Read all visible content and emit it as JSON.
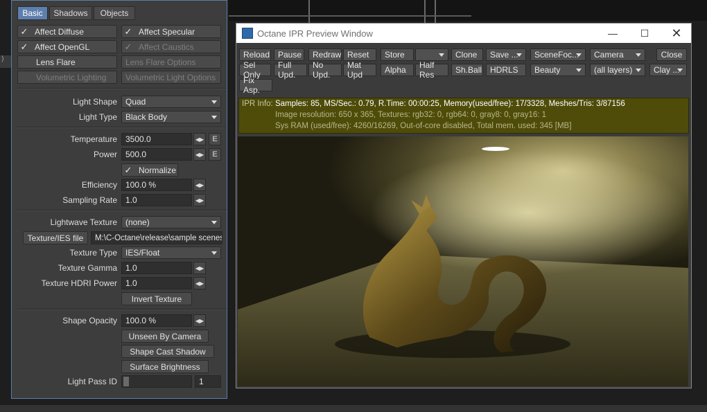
{
  "panel": {
    "tabs": [
      "Basic",
      "Shadows",
      "Objects"
    ],
    "affect_diffuse": "Affect Diffuse",
    "affect_specular": "Affect Specular",
    "affect_opengl": "Affect OpenGL",
    "affect_caustics": "Affect Caustics",
    "lens_flare": "Lens Flare",
    "lens_flare_options": "Lens Flare Options",
    "volumetric_lighting": "Volumetric Lighting",
    "volumetric_light_options": "Volumetric Light Options",
    "light_shape_label": "Light Shape",
    "light_shape_value": "Quad",
    "light_type_label": "Light Type",
    "light_type_value": "Black Body",
    "temperature_label": "Temperature",
    "temperature_value": "3500.0",
    "power_label": "Power",
    "power_value": "500.0",
    "e_label": "E",
    "normalize": "Normalize",
    "efficiency_label": "Efficiency",
    "efficiency_value": "100.0 %",
    "sampling_rate_label": "Sampling Rate",
    "sampling_rate_value": "1.0",
    "lightwave_texture_label": "Lightwave Texture",
    "lightwave_texture_value": "(none)",
    "texture_ies_button": "Texture/IES file",
    "texture_ies_path": "M:\\C-Octane\\release\\sample scenes\\",
    "texture_type_label": "Texture Type",
    "texture_type_value": "IES/Float",
    "texture_gamma_label": "Texture Gamma",
    "texture_gamma_value": "1.0",
    "texture_hdri_power_label": "Texture HDRI Power",
    "texture_hdri_power_value": "1.0",
    "invert_texture": "Invert Texture",
    "shape_opacity_label": "Shape Opacity",
    "shape_opacity_value": "100.0 %",
    "unseen_by_camera": "Unseen By Camera",
    "shape_cast_shadow": "Shape Cast Shadow",
    "surface_brightness": "Surface Brightness",
    "light_pass_id_label": "Light Pass ID",
    "light_pass_id_value": "1"
  },
  "ipr": {
    "title": "Octane IPR Preview Window",
    "toolbar_row1": [
      "Reload",
      "Pause",
      "Redraw",
      "Reset",
      "Store",
      "",
      "Clone",
      "Save ...",
      "SceneFoc...",
      "Camera",
      "Close"
    ],
    "toolbar_row2": [
      "Sel Only",
      "Full Upd.",
      "No Upd.",
      "Mat Upd",
      "Alpha",
      "Half Res",
      "Sh.Ball",
      "HDRLS",
      "Beauty",
      "(all layers)",
      "Clay ..."
    ],
    "toolbar_row3": [
      "Fix Asp."
    ],
    "info_label": "IPR Info:",
    "info_line1": "Samples: 85, MS/Sec.: 0.79, R.Time: 00:00:25, Memory(used/free): 17/3328, Meshes/Tris: 3/87156",
    "info_line2": "Image resolution: 650 x 365, Textures:  rgb32: 0, rgb64: 0, gray8: 0, gray16: 1",
    "info_line3": "Sys RAM (used/free): 4260/16269, Out-of-core disabled, Total mem. used: 345  [MB]"
  }
}
